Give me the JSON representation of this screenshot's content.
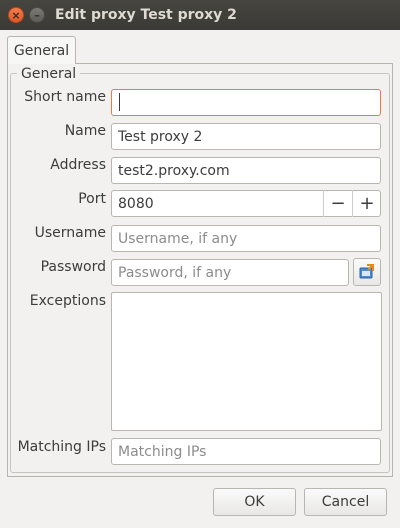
{
  "window": {
    "title": "Edit proxy Test proxy 2",
    "close_glyph": "×",
    "minimize_glyph": "–"
  },
  "tabs": [
    {
      "label": "General",
      "active": true
    }
  ],
  "group": {
    "legend": "General"
  },
  "fields": {
    "short_name": {
      "label": "Short name",
      "value": "",
      "placeholder": ""
    },
    "name": {
      "label": "Name",
      "value": "Test proxy 2"
    },
    "address": {
      "label": "Address",
      "value": "test2.proxy.com"
    },
    "port": {
      "label": "Port",
      "value": "8080",
      "decrement": "−",
      "increment": "+"
    },
    "username": {
      "label": "Username",
      "value": "",
      "placeholder": "Username, if any"
    },
    "password": {
      "label": "Password",
      "value": "",
      "placeholder": "Password, if any",
      "button_icon": "password-generate-icon"
    },
    "exceptions": {
      "label": "Exceptions",
      "value": ""
    },
    "matching_ips": {
      "label": "Matching IPs",
      "value": "",
      "placeholder": "Matching IPs"
    }
  },
  "buttons": {
    "ok": "OK",
    "cancel": "Cancel"
  },
  "colors": {
    "titlebar": "#3b3a36",
    "close_button": "#e95420",
    "focus_border": "#f07746",
    "window_bg": "#f2f1f0"
  }
}
